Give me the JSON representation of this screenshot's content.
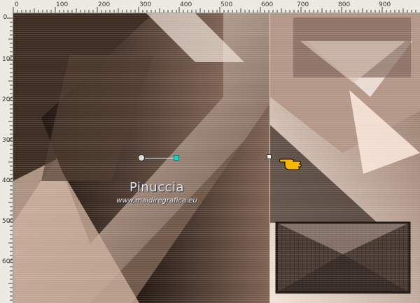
{
  "rulers": {
    "horizontal": [
      "0",
      "100",
      "200",
      "300",
      "400",
      "500",
      "600",
      "700",
      "800",
      "900"
    ],
    "vertical": [
      "0",
      "100",
      "200",
      "300",
      "400",
      "500",
      "600"
    ]
  },
  "watermark": {
    "name": "Pinuccia",
    "url": "www.maidiregrafica.eu"
  },
  "colors": {
    "ruler": "#eceae0",
    "selection_handle": "#18d3c6",
    "cursor_hand": "#f7b800"
  },
  "icons": [
    "rotation-pivot-icon",
    "rotation-handle-icon",
    "move-hand-cursor-icon"
  ]
}
